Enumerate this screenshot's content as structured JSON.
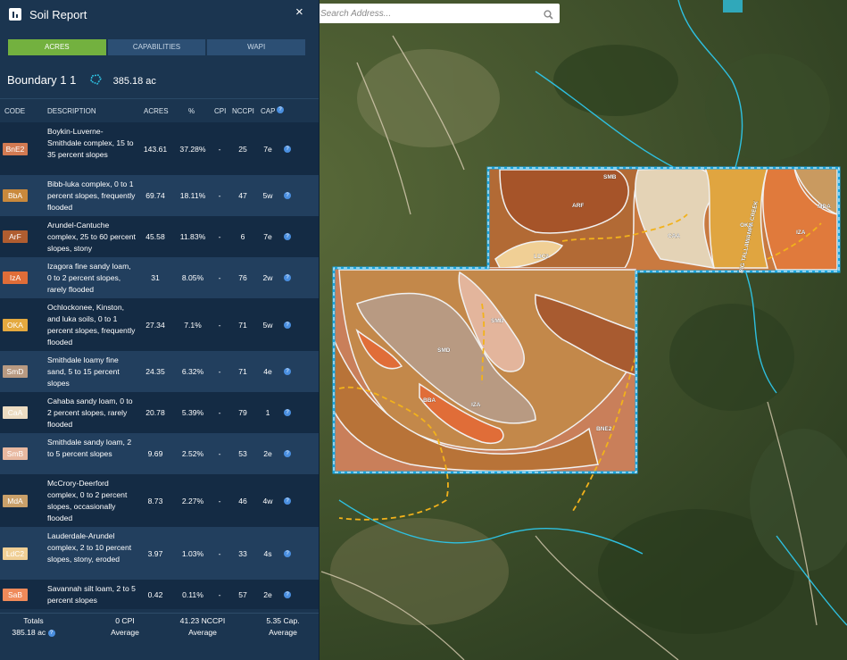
{
  "panel": {
    "title": "Soil Report",
    "close": "×",
    "tabs": [
      "ACRES",
      "CAPABILITIES",
      "WAPI"
    ],
    "boundary_name": "Boundary 1 1",
    "boundary_area": "385.18 ac",
    "columns": [
      "CODE",
      "DESCRIPTION",
      "ACRES",
      "%",
      "CPI",
      "NCCPI",
      "CAP"
    ]
  },
  "soils": [
    {
      "code": "BnE2",
      "color": "#d27a52",
      "desc": "Boykin-Luverne-Smithdale complex, 15 to 35 percent slopes",
      "acres": "143.61",
      "pct": "37.28%",
      "cpi": "-",
      "nccpi": "25",
      "cap": "7e",
      "lines": 4
    },
    {
      "code": "BbA",
      "color": "#c9893c",
      "desc": "Bibb-luka complex, 0 to 1 percent slopes, frequently flooded",
      "acres": "69.74",
      "pct": "18.11%",
      "cpi": "-",
      "nccpi": "47",
      "cap": "5w",
      "lines": 3
    },
    {
      "code": "ArF",
      "color": "#b05d30",
      "desc": "Arundel-Cantuche complex, 25 to 60 percent slopes, stony",
      "acres": "45.58",
      "pct": "11.83%",
      "cpi": "-",
      "nccpi": "6",
      "cap": "7e",
      "lines": 3
    },
    {
      "code": "IzA",
      "color": "#e06d38",
      "desc": "Izagora fine sandy loam, 0 to 2 percent slopes, rarely flooded",
      "acres": "31",
      "pct": "8.05%",
      "cpi": "-",
      "nccpi": "76",
      "cap": "2w",
      "lines": 3
    },
    {
      "code": "OKA",
      "color": "#e4a93f",
      "desc": "Ochlockonee, Kinston, and luka soils, 0 to 1 percent slopes, frequently flooded",
      "acres": "27.34",
      "pct": "7.1%",
      "cpi": "-",
      "nccpi": "71",
      "cap": "5w",
      "lines": 4
    },
    {
      "code": "SmD",
      "color": "#b89a82",
      "desc": "Smithdale loamy fine sand, 5 to 15 percent slopes",
      "acres": "24.35",
      "pct": "6.32%",
      "cpi": "-",
      "nccpi": "71",
      "cap": "4e",
      "lines": 3
    },
    {
      "code": "CaA",
      "color": "#ecdcc2",
      "desc": "Cahaba sandy loam, 0 to 2 percent slopes, rarely flooded",
      "acres": "20.78",
      "pct": "5.39%",
      "cpi": "-",
      "nccpi": "79",
      "cap": "1",
      "lines": 3
    },
    {
      "code": "SmB",
      "color": "#e8b8a0",
      "desc": "Smithdale sandy loam, 2 to 5 percent slopes",
      "acres": "9.69",
      "pct": "2.52%",
      "cpi": "-",
      "nccpi": "53",
      "cap": "2e",
      "lines": 3
    },
    {
      "code": "MdA",
      "color": "#c9a06a",
      "desc": "McCrory-Deerford complex, 0 to 2 percent slopes, occasionally flooded",
      "acres": "8.73",
      "pct": "2.27%",
      "cpi": "-",
      "nccpi": "46",
      "cap": "4w",
      "lines": 4
    },
    {
      "code": "LdC2",
      "color": "#f0cf95",
      "desc": "Lauderdale-Arundel complex, 2 to 10 percent slopes, stony, eroded",
      "acres": "3.97",
      "pct": "1.03%",
      "cpi": "-",
      "nccpi": "33",
      "cap": "4s",
      "lines": 4
    },
    {
      "code": "SaB",
      "color": "#ef8a5a",
      "desc": "Savannah silt loam, 2 to 5 percent slopes",
      "acres": "0.42",
      "pct": "0.11%",
      "cpi": "-",
      "nccpi": "57",
      "cap": "2e",
      "lines": 2
    }
  ],
  "totals": {
    "label": "Totals",
    "acres": "385.18 ac",
    "cpi": "0 CPI",
    "nccpi": "41.23 NCCPI",
    "cap": "5.35 Cap.",
    "avg": "Average"
  },
  "search": {
    "placeholder": "Search Address..."
  },
  "map_labels": {
    "smb_top": "SMB",
    "arf": "ARF",
    "caa": "CAA",
    "oka": "OKA",
    "mda": "MDA",
    "iza_right": "IZA",
    "ldc2": "LDC2",
    "smb_mid": "SMB",
    "smd": "SMD",
    "bba": "BBA",
    "iza_left": "IZA",
    "bne2": "BNE2",
    "creek": "BIG TALLAWAMPA CREEK"
  },
  "colors": {
    "panel": "#1b3550",
    "accent": "#73b13f",
    "boundary": "#1aa6e0",
    "road": "#f2b21b"
  }
}
